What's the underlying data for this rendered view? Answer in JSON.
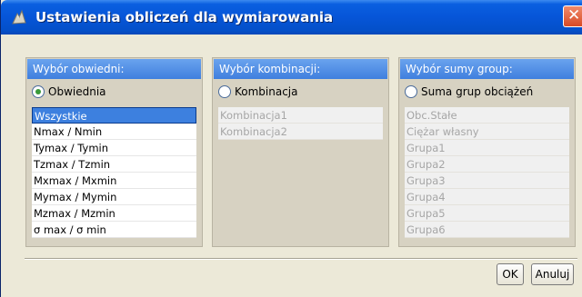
{
  "window": {
    "title": "Ustawienia obliczeń dla wymiarowania",
    "close_label": "✕"
  },
  "panels": {
    "envelopes": {
      "header": "Wybór obwiedni:",
      "radio_label": "Obwiednia",
      "radio_checked": true,
      "items": [
        "Wszystkie",
        "Nmax / Nmin",
        "Tymax / Tymin",
        "Tzmax / Tzmin",
        "Mxmax / Mxmin",
        "Mymax / Mymin",
        "Mzmax / Mzmin",
        "σ max / σ min"
      ],
      "selected_index": 0
    },
    "combinations": {
      "header": "Wybór kombinacji:",
      "radio_label": "Kombinacja",
      "radio_checked": false,
      "items": [
        "Kombinacja1",
        "Kombinacja2"
      ]
    },
    "group_sums": {
      "header": "Wybór sumy group:",
      "radio_label": "Suma grup obciążeń",
      "radio_checked": false,
      "items": [
        "Obc.Stałe",
        "Ciężar własny",
        "Grupa1",
        "Grupa2",
        "Grupa3",
        "Grupa4",
        "Grupa5",
        "Grupa6"
      ]
    }
  },
  "buttons": {
    "ok_label": "OK",
    "cancel_label": "Anuluj"
  }
}
